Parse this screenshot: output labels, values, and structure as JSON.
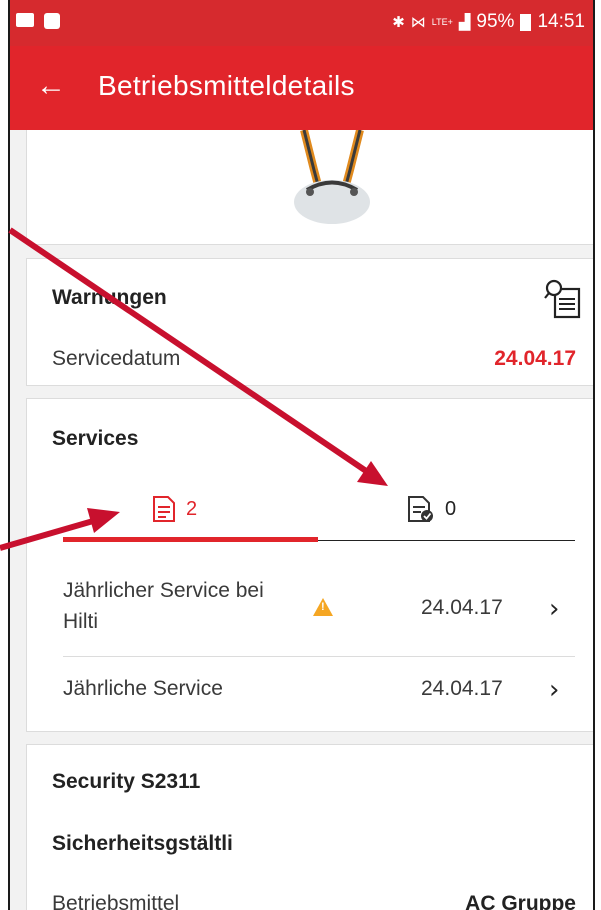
{
  "status_bar": {
    "signal_text": "LTE+",
    "battery": "95%",
    "time": "14:51"
  },
  "app_bar": {
    "title": "Betriebsmitteldetails"
  },
  "warnings": {
    "heading": "Warnungen",
    "label": "Servicedatum",
    "date": "24.04.17"
  },
  "services": {
    "heading": "Services",
    "tabs": [
      {
        "count": "2"
      },
      {
        "count": "0"
      }
    ],
    "items": [
      {
        "line1": "Jährlicher Service bei",
        "line2": "Hilti",
        "date": "24.04.17"
      },
      {
        "line1": "Jährliche Service",
        "date": "24.04.17"
      }
    ]
  },
  "asset": {
    "name": "Security S2311",
    "type": "Sicherheitsgstältli",
    "row_label": "Betriebsmittel",
    "row_value": "AC Gruppe"
  },
  "colors": {
    "brand_red": "#e1252b",
    "warning": "#f5a623"
  }
}
